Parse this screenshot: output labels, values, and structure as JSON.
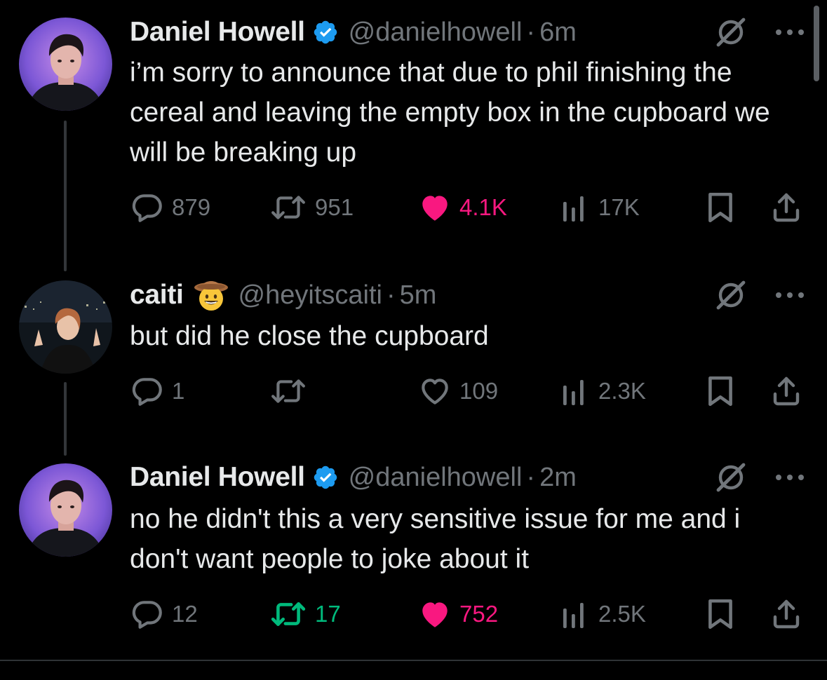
{
  "tweets": [
    {
      "name": "Daniel Howell",
      "verified": true,
      "handle": "@danielhowell",
      "separator": "·",
      "time": "6m",
      "text": "i’m sorry to announce that due to phil finishing the cereal and leaving the empty box in the cupboard we will be breaking up",
      "replies": "879",
      "reposts": "951",
      "likes": "4.1K",
      "liked": true,
      "reposted": false,
      "views": "17K"
    },
    {
      "name": "caiti",
      "emoji": "cowboy-face",
      "handle": "@heyitscaiti",
      "separator": "·",
      "time": "5m",
      "text": "but did he close the cupboard",
      "replies": "1",
      "reposts": "",
      "likes": "109",
      "liked": false,
      "reposted": false,
      "views": "2.3K"
    },
    {
      "name": "Daniel Howell",
      "verified": true,
      "handle": "@danielhowell",
      "separator": "·",
      "time": "2m",
      "text": "no he didn't this a very sensitive issue for me and i don't want people to joke about it",
      "replies": "12",
      "reposts": "17",
      "likes": "752",
      "liked": true,
      "reposted": true,
      "views": "2.5K"
    }
  ],
  "colors": {
    "background": "#000000",
    "text": "#e7e9ea",
    "muted": "#71767b",
    "like": "#f91880",
    "repost": "#00ba7c",
    "verified": "#1d9bf0",
    "thread_line": "#333639"
  }
}
